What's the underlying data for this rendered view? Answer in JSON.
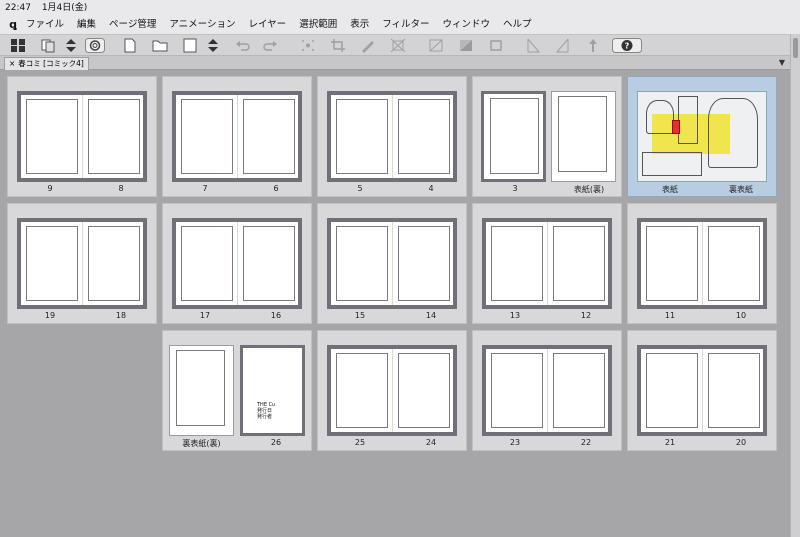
{
  "status": {
    "time": "22:47",
    "date": "1月4日(金)"
  },
  "menu": [
    "ファイル",
    "編集",
    "ページ管理",
    "アニメーション",
    "レイヤー",
    "選択範囲",
    "表示",
    "フィルター",
    "ウィンドウ",
    "ヘルプ"
  ],
  "document_tab": {
    "title": "春コミ [コミック4]",
    "close_glyph": "×"
  },
  "spreads": [
    {
      "id": "s1",
      "left": "9",
      "right": "8"
    },
    {
      "id": "s2",
      "left": "7",
      "right": "6"
    },
    {
      "id": "s3",
      "left": "5",
      "right": "4"
    },
    {
      "id": "s4",
      "left": "3",
      "right": "表紙(裏)"
    },
    {
      "id": "s5",
      "left": "表紙",
      "right": "裏表紙"
    },
    {
      "id": "s6",
      "left": "19",
      "right": "18"
    },
    {
      "id": "s7",
      "left": "17",
      "right": "16"
    },
    {
      "id": "s8",
      "left": "15",
      "right": "14"
    },
    {
      "id": "s9",
      "left": "13",
      "right": "12"
    },
    {
      "id": "s10",
      "left": "11",
      "right": "10"
    },
    {
      "id": "s11",
      "left": "裏表紙(裏)",
      "right": "26"
    },
    {
      "id": "s12",
      "left": "25",
      "right": "24"
    },
    {
      "id": "s13",
      "left": "23",
      "right": "22"
    },
    {
      "id": "s14",
      "left": "21",
      "right": "20"
    }
  ],
  "page26_text": [
    "THE Cu",
    "発行日",
    "発行者"
  ],
  "icons": {
    "toolbar": [
      "layout-grid-icon",
      "pages-icon",
      "updown-icon",
      "swirl-icon",
      "new-page-icon",
      "open-folder-icon",
      "page-frame-icon",
      "updown2-icon",
      "undo-icon",
      "redo-icon",
      "sparkle-icon",
      "crop-icon",
      "pen-icon",
      "transform-icon",
      "fill-icon",
      "gradient-icon",
      "square-icon",
      "ruler-icon",
      "corner-icon",
      "pin-icon",
      "help-icon"
    ]
  },
  "colors": {
    "selected_spread": "#b8cde2",
    "cover_yellow": "#f0e33a"
  }
}
